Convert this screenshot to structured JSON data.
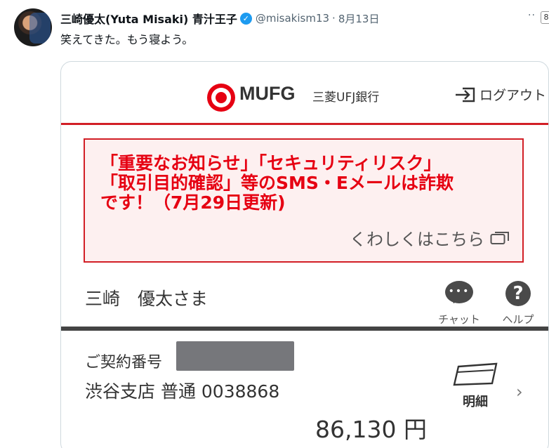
{
  "tweet": {
    "display_name": "三崎優太(Yuta Misaki) 青汁王子",
    "handle": "@misakism13",
    "separator": "·",
    "date": "8月13日",
    "more": "··",
    "grok": "8",
    "text": "笑えてきた。もう寝よう。",
    "verified_color": "#1d9bf0"
  },
  "bank_screen": {
    "brand": "MUFG",
    "brand_jp": "三菱UFJ銀行",
    "brand_color": "#e60012",
    "logout_label": "ログアウト",
    "notice": {
      "lines": [
        "「重要なお知らせ」「セキュリティリスク」",
        "「取引目的確認」等のSMS・Eメールは詐欺",
        "です！（7月29日更新)"
      ],
      "link_label": "くわしくはこちら"
    },
    "customer_name": "三崎　優太さま",
    "chat_label": "チャット",
    "help_label": "ヘルプ",
    "help_symbol": "?",
    "chat_symbol": "•••",
    "account": {
      "contract_label": "ご契約番号",
      "branch_line": "渋谷支店 普通 0038868",
      "balance": "86,130 円",
      "statement_label": "明細",
      "chevron": "›"
    }
  }
}
